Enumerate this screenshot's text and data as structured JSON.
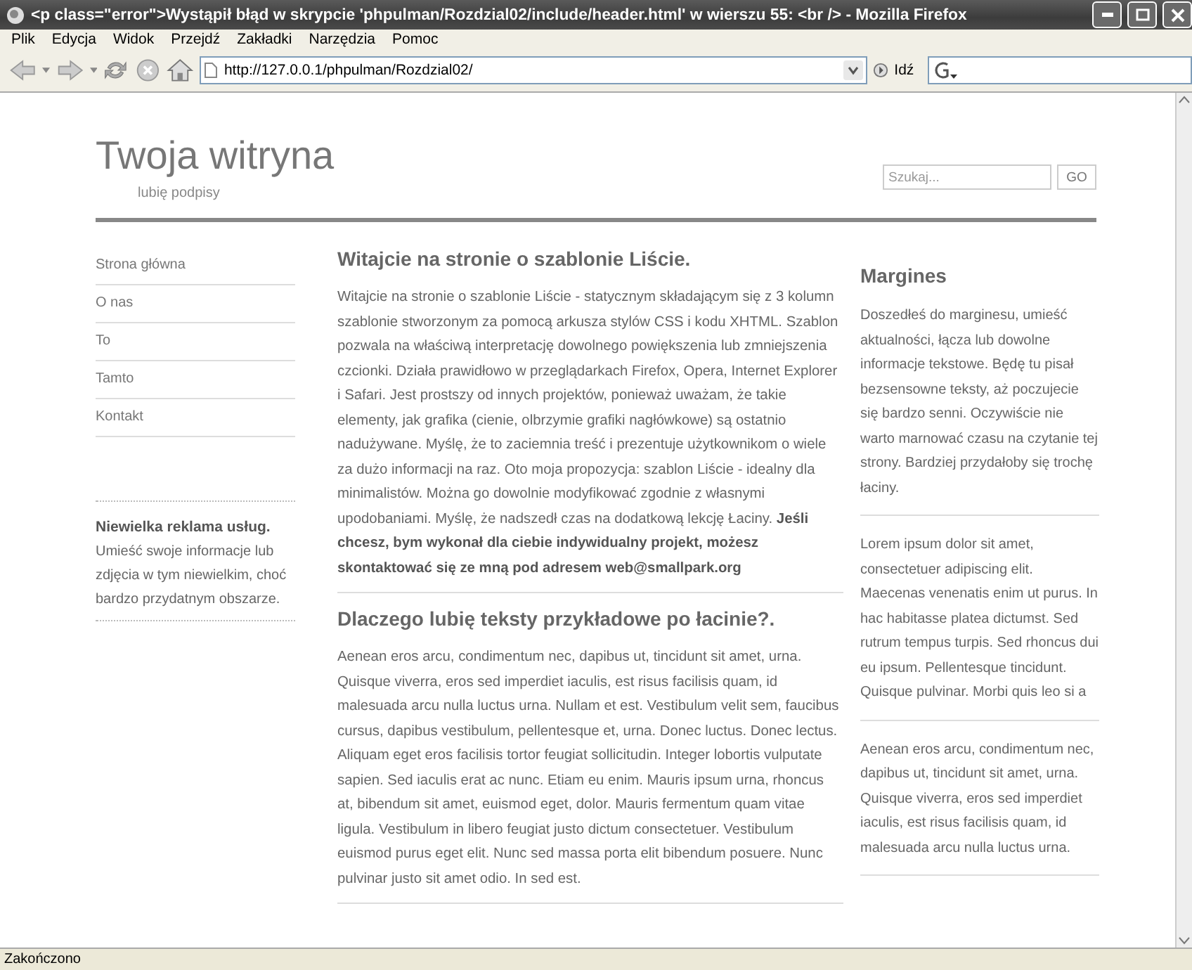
{
  "window": {
    "title": "<p class=\"error\">Wystąpił błąd w skrypcie 'phpulman/Rozdzial02/include/header.html' w wierszu 55: <br /> - Mozilla Firefox"
  },
  "menu": [
    "Plik",
    "Edycja",
    "Widok",
    "Przejdź",
    "Zakładki",
    "Narzędzia",
    "Pomoc"
  ],
  "toolbar": {
    "address": "http://127.0.0.1/phpulman/Rozdzial02/",
    "go_label": "Idź"
  },
  "page": {
    "site_title": "Twoja witryna",
    "tagline": "lubię podpisy",
    "search": {
      "placeholder": "Szukaj...",
      "button": "GO"
    },
    "nav": [
      "Strona główna",
      "O nas",
      "To",
      "Tamto",
      "Kontakt"
    ],
    "ad": {
      "title": "Niewielka reklama usług.",
      "text": "Umieść swoje informacje lub zdjęcia w tym niewielkim, choć bardzo przydatnym obszarze."
    },
    "main": [
      {
        "heading": "Witajcie na stronie o szablonie Liście.",
        "text": "Witajcie na stronie o szablonie Liście - statycznym składającym się z 3 kolumn szablonie stworzonym za pomocą arkusza stylów CSS i kodu XHTML. Szablon pozwala na właściwą interpretację dowolnego powiększenia lub zmniejszenia czcionki. Działa prawidłowo w przeglądarkach Firefox, Opera, Internet Explorer i Safari. Jest prostszy od innych projektów, ponieważ uważam, że takie elementy, jak grafika (cienie, olbrzymie grafiki nagłówkowe) są ostatnio nadużywane. Myślę, że to zaciemnia treść i prezentuje użytkownikom o wiele za dużo informacji na raz. Oto moja propozycja: szablon Liście - idealny dla minimalistów. Można go dowolnie modyfikować zgodnie z własnymi upodobaniami. Myślę, że nadszedł czas na dodatkową lekcję Łaciny. **Jeśli chcesz, bym wykonał dla ciebie indywidualny projekt, możesz skontaktować się ze mną pod adresem web@smallpark.org**"
      },
      {
        "heading": "Dlaczego lubię teksty przykładowe po łacinie?.",
        "text": "Aenean eros arcu, condimentum nec, dapibus ut, tincidunt sit amet, urna. Quisque viverra, eros sed imperdiet iaculis, est risus facilisis quam, id malesuada arcu nulla luctus urna. Nullam et est. Vestibulum velit sem, faucibus cursus, dapibus vestibulum, pellentesque et, urna. Donec luctus. Donec lectus. Aliquam eget eros facilisis tortor feugiat sollicitudin. Integer lobortis vulputate sapien. Sed iaculis erat ac nunc. Etiam eu enim. Mauris ipsum urna, rhoncus at, bibendum sit amet, euismod eget, dolor. Mauris fermentum quam vitae ligula. Vestibulum in libero feugiat justo dictum consectetuer. Vestibulum euismod purus eget elit. Nunc sed massa porta elit bibendum posuere. Nunc pulvinar justo sit amet odio. In sed est."
      }
    ],
    "sidebar": {
      "heading": "Margines",
      "paragraphs": [
        "Doszedłeś do marginesu, umieść aktualności, łącza lub dowolne informacje tekstowe. Będę tu pisał bezsensowne teksty, aż poczujecie się bardzo senni. Oczywiście nie warto marnować czasu na czytanie tej strony. Bardziej przydałoby się trochę łaciny.",
        "Lorem ipsum dolor sit amet, consectetuer adipiscing elit. Maecenas venenatis enim ut purus. In hac habitasse platea dictumst. Sed rutrum tempus turpis. Sed rhoncus dui eu ipsum. Pellentesque tincidunt. Quisque pulvinar. Morbi quis leo si a",
        "Aenean eros arcu, condimentum nec, dapibus ut, tincidunt sit amet, urna. Quisque viverra, eros sed imperdiet iaculis, est risus facilisis quam, id malesuada arcu nulla luctus urna."
      ]
    }
  },
  "status_bar": "Zakończono"
}
